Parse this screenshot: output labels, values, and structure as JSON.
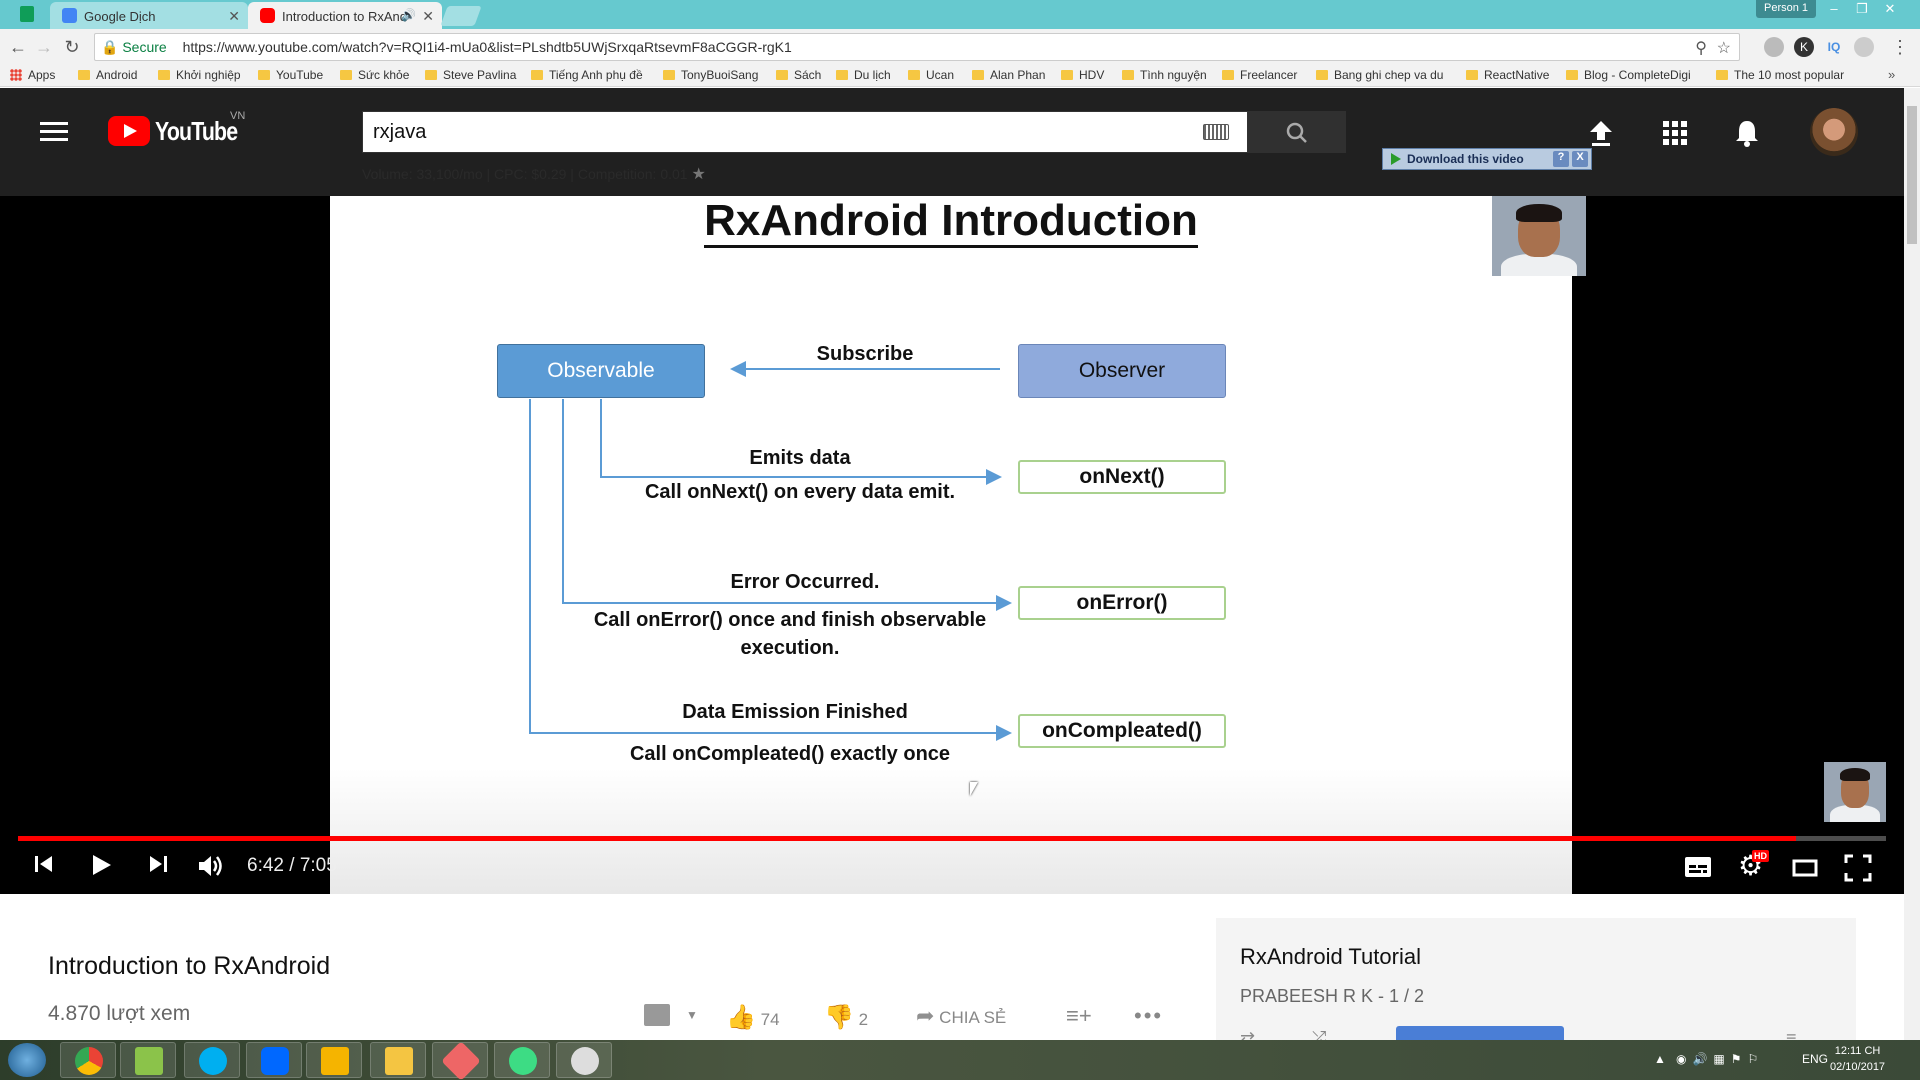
{
  "browser": {
    "tabs": [
      {
        "title": "Google Dịch"
      },
      {
        "title": "Introduction to RxAnd"
      }
    ],
    "person": "Person 1",
    "secure_label": "Secure",
    "url": "https://www.youtube.com/watch?v=RQI1i4-mUa0&list=PLshdtb5UWjSrxqaRtsevmF8aCGGR-rgK1",
    "bookmarks": [
      "Apps",
      "Android",
      "Khởi nghiệp",
      "YouTube",
      "Sức khỏe",
      "Steve Pavlina",
      "Tiếng Anh phụ đề",
      "TonyBuoiSang",
      "Sách",
      "Du lịch",
      "Ucan",
      "Alan Phan",
      "HDV",
      "Tình nguyện",
      "Freelancer",
      "Bang ghi chep va du",
      "ReactNative",
      "Blog - CompleteDigi",
      "The 10 most popular"
    ]
  },
  "youtube": {
    "logo_text": "YouTube",
    "region": "VN",
    "search_value": "rxjava",
    "keyword_stats": "Volume: 33,100/mo | CPC: $0.29 | Competition: 0.01",
    "download_label": "Download this video",
    "download_help": "?",
    "download_close": "X"
  },
  "slide": {
    "title": "RxAndroid Introduction",
    "observable": "Observable",
    "observer": "Observer",
    "subscribe": "Subscribe",
    "emits_title": "Emits data",
    "emits_desc": "Call onNext() on every data emit.",
    "on_next": "onNext()",
    "error_title": "Error Occurred.",
    "error_desc1": "Call onError() once and finish observable",
    "error_desc2": "execution.",
    "on_error": "onError()",
    "finished_title": "Data Emission Finished",
    "finished_desc": "Call onCompleated() exactly once",
    "on_completed": "onCompleated()"
  },
  "player": {
    "time": "6:42 / 7:05",
    "progress": 0.952,
    "hd_badge": "HD"
  },
  "video": {
    "title": "Introduction to RxAndroid",
    "views": "4.870 lượt xem",
    "likes": "74",
    "dislikes": "2",
    "share": "CHIA SẺ"
  },
  "playlist": {
    "title": "RxAndroid Tutorial",
    "subtitle": "PRABEESH R K - 1 / 2"
  },
  "taskbar": {
    "lang": "ENG",
    "time": "12:11 CH",
    "date": "02/10/2017"
  }
}
